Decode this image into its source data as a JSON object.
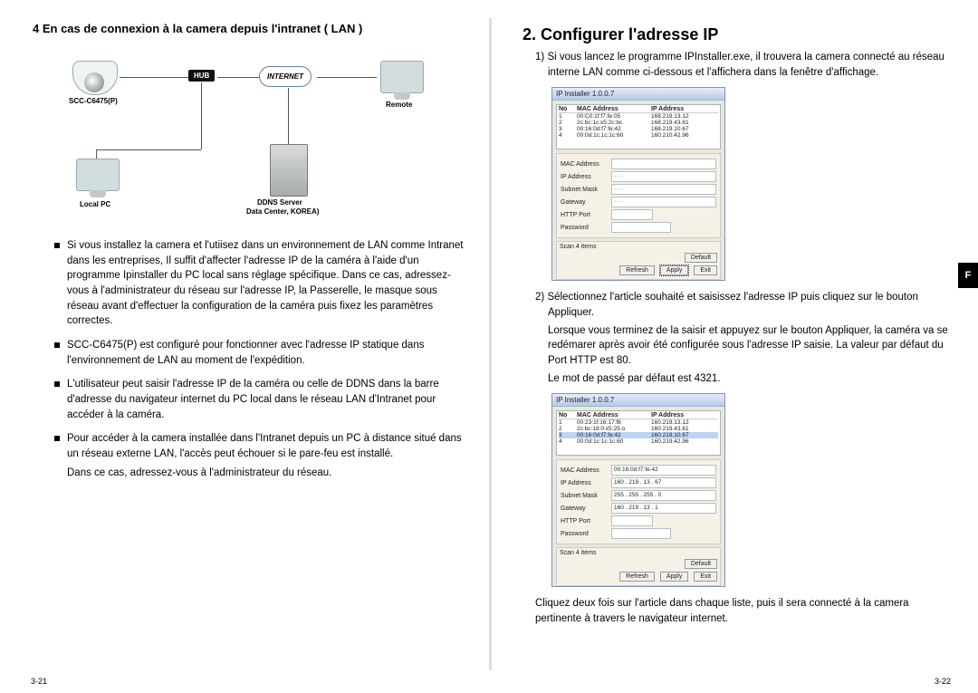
{
  "side_tab": "F",
  "page_left": "3-21",
  "page_right": "3-22",
  "left": {
    "heading4": "4 En cas de connexion à la camera depuis l'intranet ( LAN )",
    "diagram": {
      "hub": "HUB",
      "internet": "INTERNET",
      "camera_model": "SCC-C6475(P)",
      "remote": "Remote",
      "local_pc": "Local PC",
      "ddns_line1": "DDNS Server",
      "ddns_line2": "Data Center, KOREA)"
    },
    "bullets": [
      "Si vous installez la camera et l'utiisez dans un environnement de  LAN comme Intranet dans les entreprises, Il suffit d'affecter l'adresse IP de la caméra à l'aide d'un programme Ipinstaller du PC local sans réglage spécifique. Dans ce cas, adressez-vous à l'administrateur du réseau sur l'adresse IP, la Passerelle, le masque sous réseau avant d'effectuer la configuration de la caméra puis fixez les paramètres correctes.",
      "SCC-C6475(P) est configuré pour fonctionner avec l'adresse IP statique dans l'environnement de LAN au moment de l'expédition.",
      "L'utilisateur peut saisir l'adresse IP de la caméra ou celle de DDNS dans la barre d'adresse du navigateur internet du PC local dans le réseau LAN d'Intranet pour accéder à la caméra.",
      "Pour accéder à la camera installée dans l'Intranet depuis un PC à distance situé dans un réseau externe LAN, l'accès peut échouer si le pare-feu est installé."
    ],
    "after_bullets": "Dans ce cas, adressez-vous à l'administrateur du réseau."
  },
  "right": {
    "section_title": "2. Configurer l'adresse IP",
    "p1_lead": "1)",
    "p1": "Si vous lancez le programme IPInstaller.exe, il trouvera la camera connecté au réseau interne LAN comme ci-dessous et l'affichera dans la fenêtre d'affichage.",
    "ipwin1": {
      "title": "IP Installer 1.0.0.7",
      "list_hdr_no": "No",
      "list_hdr_mac": "MAC Address",
      "list_hdr_ip": "IP Address",
      "rows": [
        {
          "n": "1",
          "mac": "00:C0:1f:f7:fe:05",
          "ip": "168.219.13.12"
        },
        {
          "n": "2",
          "mac": "2c:bc:1c:x5:2c:bc",
          "ip": "168.219.43.61"
        },
        {
          "n": "3",
          "mac": "00:16:0d:f7:fe:42",
          "ip": "168.219.10.67"
        },
        {
          "n": "4",
          "mac": "00:0d:1c:1c:1c:60",
          "ip": "160.210.42.96"
        }
      ],
      "fields": {
        "mac": "MAC Address",
        "ip": "IP Address",
        "subnet": "Subnet Mask",
        "gateway": "Gateway",
        "http": "HTTP Port",
        "password": "Password"
      },
      "scan": "Scan 4 items",
      "btn_default": "Default",
      "btn_refresh": "Refresh",
      "btn_apply": "Apply",
      "btn_exit": "Exit"
    },
    "p2_lead": "2)",
    "p2": "Sélectionnez l'article souhaité et saisissez l'adresse IP puis cliquez sur le bouton Appliquer.",
    "p2b": "Lorsque vous terminez de la saisir et appuyez sur le bouton Appliquer, la caméra va se redémarer après avoir été configurée sous l'adresse IP saisie. La valeur par défaut du Port HTTP est 80.",
    "p2c": "Le mot de passé par défaut est 4321.",
    "ipwin2": {
      "title": "IP Installer 1.0.0.7",
      "list_hdr_no": "No",
      "list_hdr_mac": "MAC Address",
      "list_hdr_ip": "IP Address",
      "rows": [
        {
          "n": "1",
          "mac": "00:23:1f:16:17:f8",
          "ip": "160.219.13.12"
        },
        {
          "n": "2",
          "mac": "2c:bc:18:0:x5:25:o",
          "ip": "160.219.43.61"
        },
        {
          "n": "3",
          "mac": "00:16:0d:f7:fe:42",
          "ip": "160.219.10.67"
        },
        {
          "n": "4",
          "mac": "00:0d:1c:1c:1c:60",
          "ip": "160.219.42.96"
        }
      ],
      "fields": {
        "mac": {
          "label": "MAC Address",
          "value": "00:16:0d:f7:fe:42"
        },
        "ip": {
          "label": "IP Address",
          "value": "160 . 219 . 13 . 67"
        },
        "subnet": {
          "label": "Subnet Mask",
          "value": "255 . 255 . 255 . 0"
        },
        "gateway": {
          "label": "Gateway",
          "value": "160 . 219 . 13 . 1"
        },
        "http": {
          "label": "HTTP Port",
          "value": ""
        },
        "password": {
          "label": "Password",
          "value": ""
        }
      },
      "scan": "Scan 4 items",
      "btn_default": "Default",
      "btn_refresh": "Refresh",
      "btn_apply": "Apply",
      "btn_exit": "Exit"
    },
    "p3": "Cliquez deux fois sur l'article dans chaque liste, puis il sera connecté à la camera pertinente à travers le navigateur internet."
  }
}
